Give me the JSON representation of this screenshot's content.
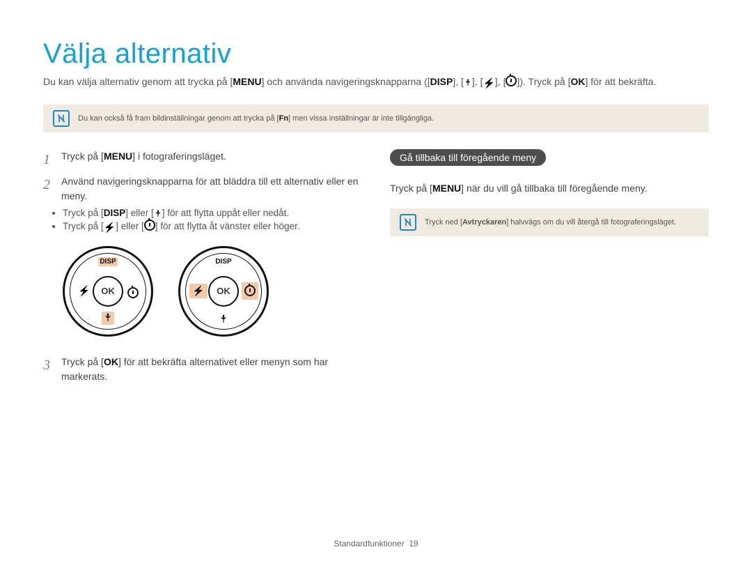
{
  "title": "Välja alternativ",
  "intro": {
    "part1": "Du kan välja alternativ genom att trycka på [",
    "menu": "MENU",
    "part2": "] och använda navigeringsknapparna ([",
    "disp": "DISP",
    "part3": "], [",
    "macro_icon": "macro-icon",
    "part4": "], [",
    "bolt_icon": "flash-icon",
    "part5": "], [",
    "timer_icon": "timer-icon",
    "part6": "]). Tryck på [",
    "ok": "OK",
    "part7": "] för att bekräfta."
  },
  "note1": {
    "prefix": "Du kan också få fram bildinställningar genom att trycka på [",
    "fn": "Fn",
    "suffix": "] men vissa inställningar är inte tillgängliga."
  },
  "steps": {
    "s1": {
      "num": "1",
      "text_a": "Tryck på [",
      "menu": "MENU",
      "text_b": "] i fotograferingsläget."
    },
    "s2": {
      "num": "2",
      "text": "Använd navigeringsknapparna för att bläddra till ett alternativ eller en meny.",
      "bullet1_a": "Tryck på [",
      "disp": "DISP",
      "bullet1_b": "] eller [",
      "bullet1_c": "] för att flytta uppåt eller nedåt.",
      "bullet2_a": "Tryck på [",
      "bullet2_b": "] eller [",
      "bullet2_c": "] för att flytta åt vänster eller höger."
    },
    "s3": {
      "num": "3",
      "text_a": "Tryck på [",
      "ok": "OK",
      "text_b": "] för att bekräfta alternativet eller menyn som har markerats."
    }
  },
  "right": {
    "pill": "Gå tillbaka till föregående meny",
    "line_a": "Tryck på [",
    "menu": "MENU",
    "line_b": "] när du vill gå tillbaka till föregående meny.",
    "note_a": "Tryck ned [",
    "note_key": "Avtryckaren",
    "note_b": "] halvvägs om du vill återgå till fotograferingsläget."
  },
  "dial": {
    "disp": "DISP",
    "ok": "OK"
  },
  "footer": {
    "section": "Standardfunktioner",
    "page": "19"
  }
}
